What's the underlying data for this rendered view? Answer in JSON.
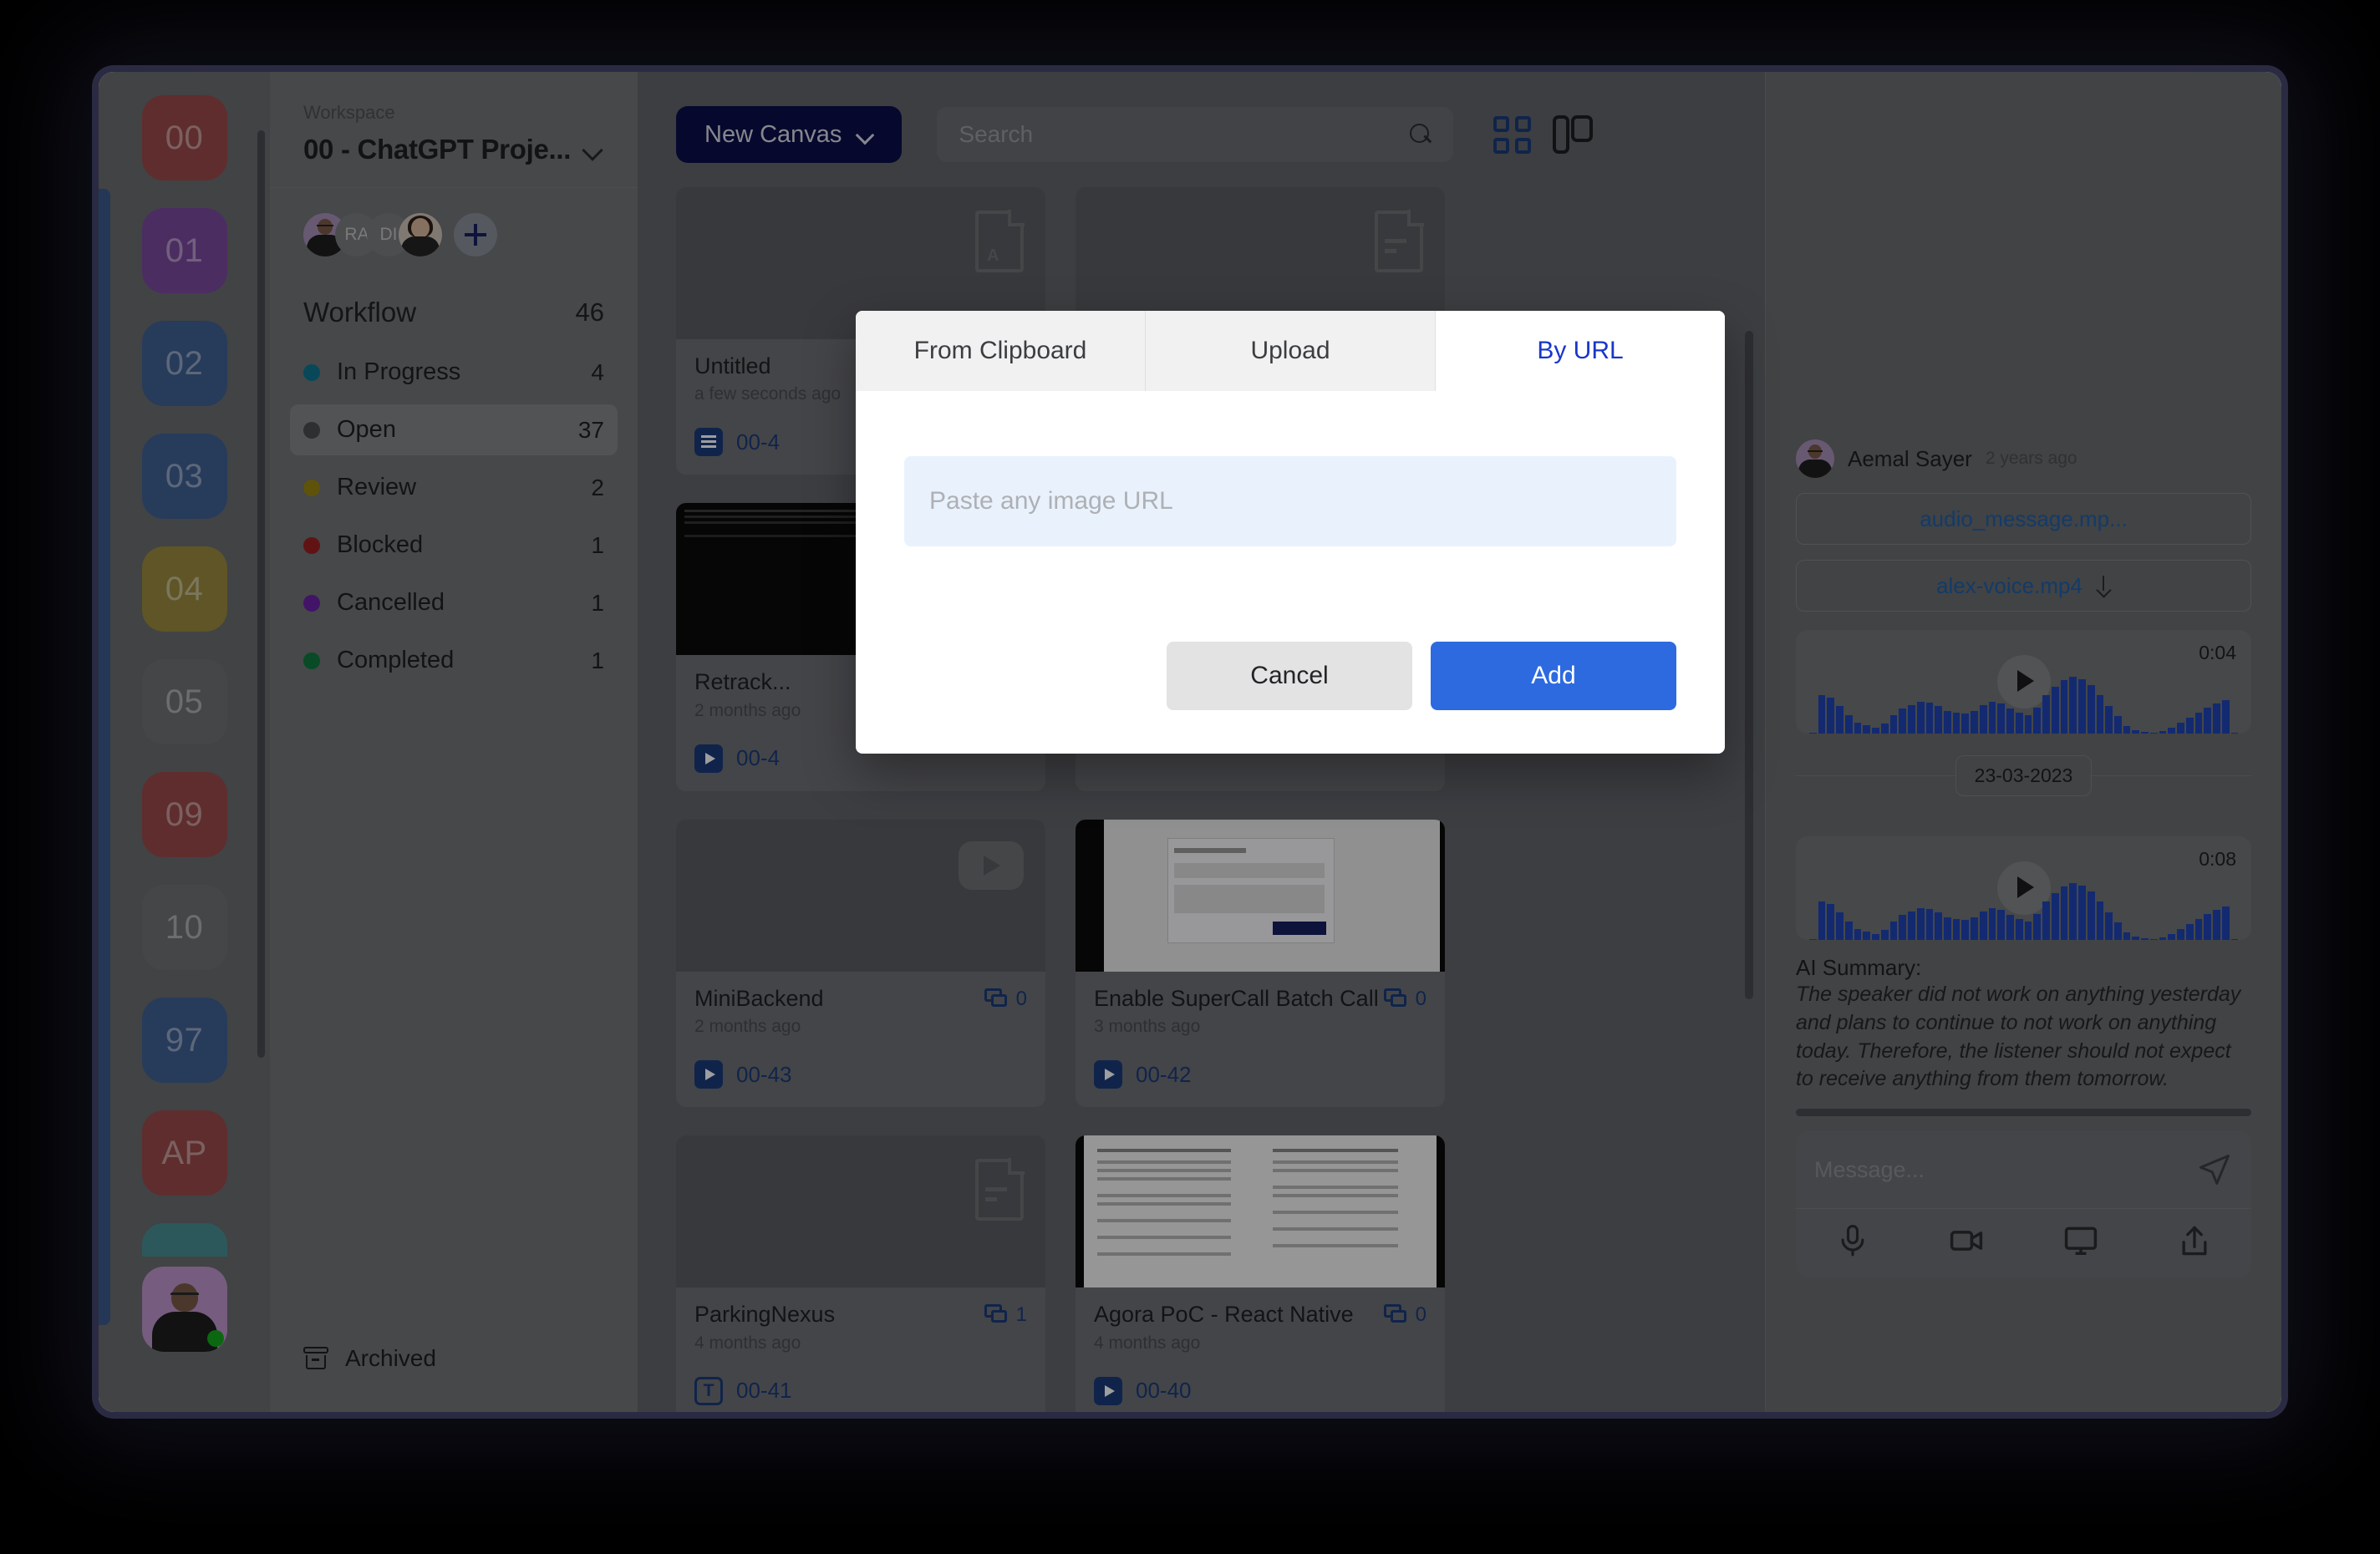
{
  "rail": {
    "items": [
      {
        "label": "00",
        "color": "#9a4a4a"
      },
      {
        "label": "01",
        "color": "#7b4a9e"
      },
      {
        "label": "02",
        "color": "#3f5f93"
      },
      {
        "label": "03",
        "color": "#3f5f93"
      },
      {
        "label": "04",
        "color": "#9a8a3e"
      },
      {
        "label": "05",
        "color": "#6f7174"
      },
      {
        "label": "09",
        "color": "#9a4a4a"
      },
      {
        "label": "10",
        "color": "#6f7174"
      },
      {
        "label": "97",
        "color": "#3f5f93"
      },
      {
        "label": "AP",
        "color": "#9a4a4a"
      },
      {
        "label": "",
        "color": "#4a8f93"
      }
    ],
    "current_user_label": "current-user"
  },
  "sidebar": {
    "workspace_label": "Workspace",
    "workspace_name": "00 - ChatGPT Proje...",
    "members": [
      {
        "initials": "",
        "type": "photo"
      },
      {
        "initials": "RA",
        "type": "initials"
      },
      {
        "initials": "DI",
        "type": "initials"
      },
      {
        "initials": "",
        "type": "photo"
      }
    ],
    "add_member_label": "+",
    "workflow_title": "Workflow",
    "workflow_count": "46",
    "statuses": [
      {
        "label": "In Progress",
        "count": "4",
        "color": "#0e7490"
      },
      {
        "label": "Open",
        "count": "37",
        "color": "#4a4c50"
      },
      {
        "label": "Review",
        "count": "2",
        "color": "#9a8512"
      },
      {
        "label": "Blocked",
        "count": "1",
        "color": "#9d1f1f"
      },
      {
        "label": "Cancelled",
        "count": "1",
        "color": "#6b21a8"
      },
      {
        "label": "Completed",
        "count": "1",
        "color": "#0d7a3e"
      }
    ],
    "archived_label": "Archived"
  },
  "toolbar": {
    "new_canvas_label": "New Canvas",
    "search_placeholder": "Search",
    "grid_view_label": "grid-view",
    "board_view_label": "board-view"
  },
  "cards": [
    {
      "title": "Untitled",
      "meta": "a few seconds ago",
      "comments": "",
      "tag": "00-4",
      "tag_icon": "doc",
      "thumb": "pdf"
    },
    {
      "title": "",
      "meta": "",
      "comments": "",
      "tag": "",
      "tag_icon": "doc",
      "thumb": "doc"
    },
    {
      "title": "Retrack...",
      "meta": "2 months ago",
      "comments": "",
      "tag": "00-4",
      "tag_icon": "play",
      "thumb": "terminal"
    },
    {
      "title": "",
      "meta": "",
      "comments": "",
      "tag": "",
      "tag_icon": "play",
      "thumb": "doc"
    },
    {
      "title": "MiniBackend",
      "meta": "2 months ago",
      "comments": "0",
      "tag": "00-43",
      "tag_icon": "play",
      "thumb": "video"
    },
    {
      "title": "Enable SuperCall Batch Call",
      "meta": "3 months ago",
      "comments": "0",
      "tag": "00-42",
      "tag_icon": "play",
      "thumb": "screenshot"
    },
    {
      "title": "ParkingNexus",
      "meta": "4 months ago",
      "comments": "1",
      "tag": "00-41",
      "tag_icon": "text",
      "thumb": "doc"
    },
    {
      "title": "Agora PoC - React Native",
      "meta": "4 months ago",
      "comments": "0",
      "tag": "00-40",
      "tag_icon": "play",
      "thumb": "document-page"
    }
  ],
  "chat": {
    "author": "Aemal Sayer",
    "timestamp": "2 years ago",
    "files": [
      {
        "name": "audio_message.mp...",
        "has_download": false
      },
      {
        "name": "alex-voice.mp4",
        "has_download": true
      }
    ],
    "voice_1_duration": "0:04",
    "date_separator": "23-03-2023",
    "voice_2_duration": "0:08",
    "ai_summary_title": "AI Summary:",
    "ai_summary_text": "The speaker did not work on anything yesterday and plans to continue to not work on anything today. Therefore, the listener should not expect to receive anything from them tomorrow.",
    "composer_placeholder": "Message...",
    "tools": [
      "microphone-icon",
      "video-camera-icon",
      "screen-share-icon",
      "upload-icon"
    ],
    "send_label": "send-icon"
  },
  "modal": {
    "tabs": [
      {
        "label": "From Clipboard",
        "active": false
      },
      {
        "label": "Upload",
        "active": false
      },
      {
        "label": "By URL",
        "active": true
      }
    ],
    "url_placeholder": "Paste any image URL",
    "cancel_label": "Cancel",
    "add_label": "Add"
  },
  "colors": {
    "accent_blue": "#2d6ae0",
    "link_blue": "#1b3a79",
    "active_tab": "#1a36c9",
    "new_canvas_bg": "#0b0f4a",
    "window_border": "#2a2a42"
  }
}
